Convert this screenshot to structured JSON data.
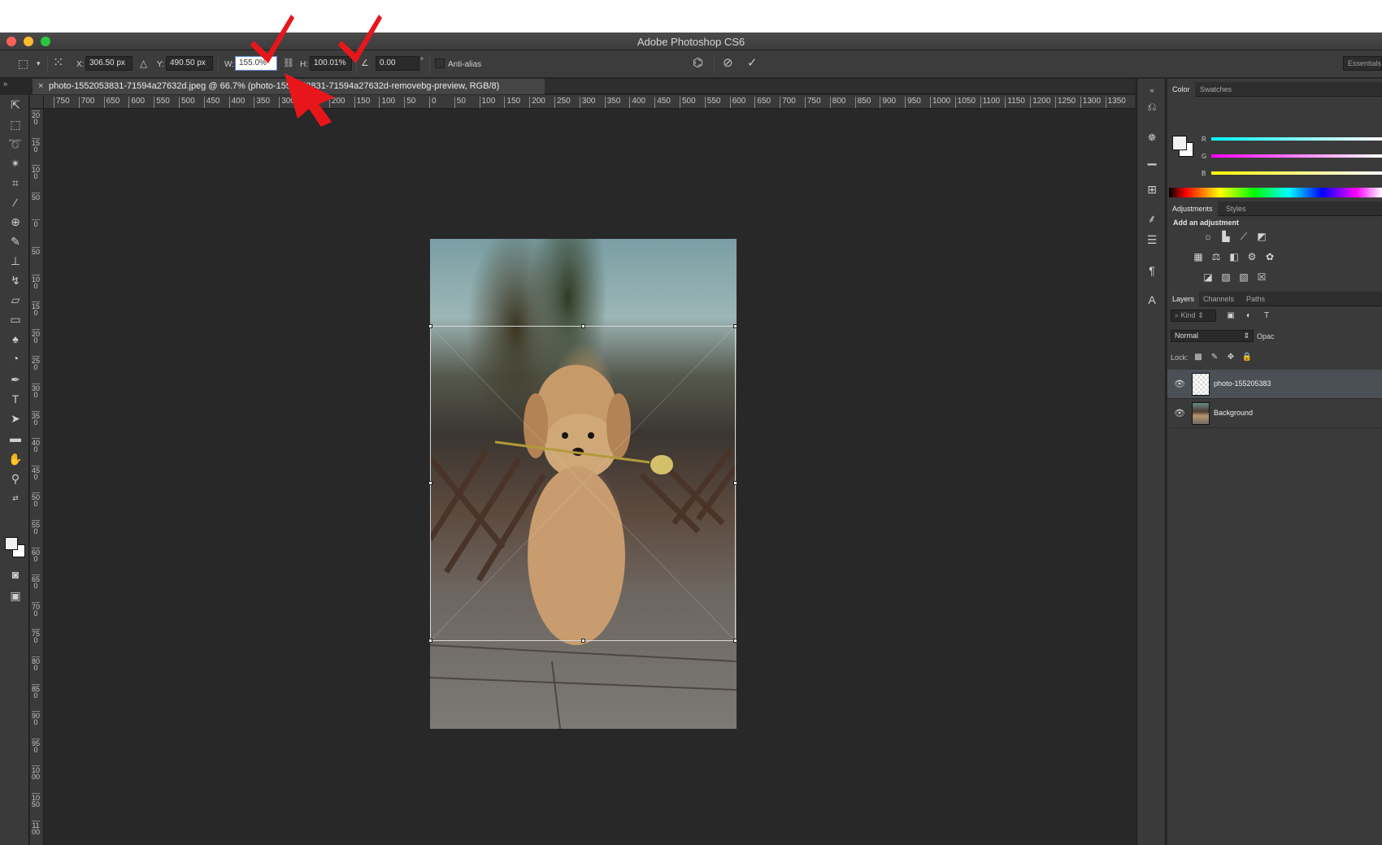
{
  "window": {
    "title": "Adobe Photoshop CS6"
  },
  "options_bar": {
    "x_label": "X:",
    "x_value": "306.50 px",
    "y_label": "Y:",
    "y_value": "490.50 px",
    "w_label": "W:",
    "w_value": "155.0%",
    "h_label": "H:",
    "h_value": "100.01%",
    "angle_value": "0.00",
    "degree_symbol": "°",
    "anti_alias_label": "Anti-alias",
    "workspace_label": "Essentials"
  },
  "document_tab": {
    "title": "photo-1552053831-71594a27632d.jpeg @ 66.7% (photo-1552053831-71594a27632d-removebg-preview, RGB/8)",
    "close": "×"
  },
  "ruler_top": [
    "750",
    "700",
    "650",
    "600",
    "550",
    "500",
    "450",
    "400",
    "350",
    "300",
    "250",
    "200",
    "150",
    "100",
    "50",
    "0",
    "50",
    "100",
    "150",
    "200",
    "250",
    "300",
    "350",
    "400",
    "450",
    "500",
    "550",
    "600",
    "650",
    "700",
    "750",
    "800",
    "850",
    "900",
    "950",
    "1000",
    "1050",
    "1100",
    "1150",
    "1200",
    "1250",
    "1300",
    "1350"
  ],
  "ruler_left": [
    "200",
    "150",
    "100",
    "50",
    "0",
    "50",
    "100",
    "150",
    "200",
    "250",
    "300",
    "350",
    "400",
    "450",
    "500",
    "550",
    "600",
    "650",
    "700",
    "750",
    "800",
    "850",
    "900",
    "950",
    "1000",
    "1050",
    "1100"
  ],
  "panels": {
    "color_tabs": [
      "Color",
      "Swatches"
    ],
    "rgb_labels": [
      "R",
      "G",
      "B"
    ],
    "adjust_tabs": [
      "Adjustments",
      "Styles"
    ],
    "adjust_title": "Add an adjustment",
    "layers_tabs": [
      "Layers",
      "Channels",
      "Paths"
    ],
    "kind_label": "Kind",
    "blend_mode": "Normal",
    "opacity_label": "Opac",
    "lock_label": "Lock:",
    "layers": [
      {
        "name": "photo-155205383",
        "selected": true
      },
      {
        "name": "Background",
        "selected": false
      }
    ]
  },
  "colors": {
    "annotation_red": "#e8161b",
    "app_bg": "#282828",
    "panel_bg": "#3a3a3a"
  }
}
